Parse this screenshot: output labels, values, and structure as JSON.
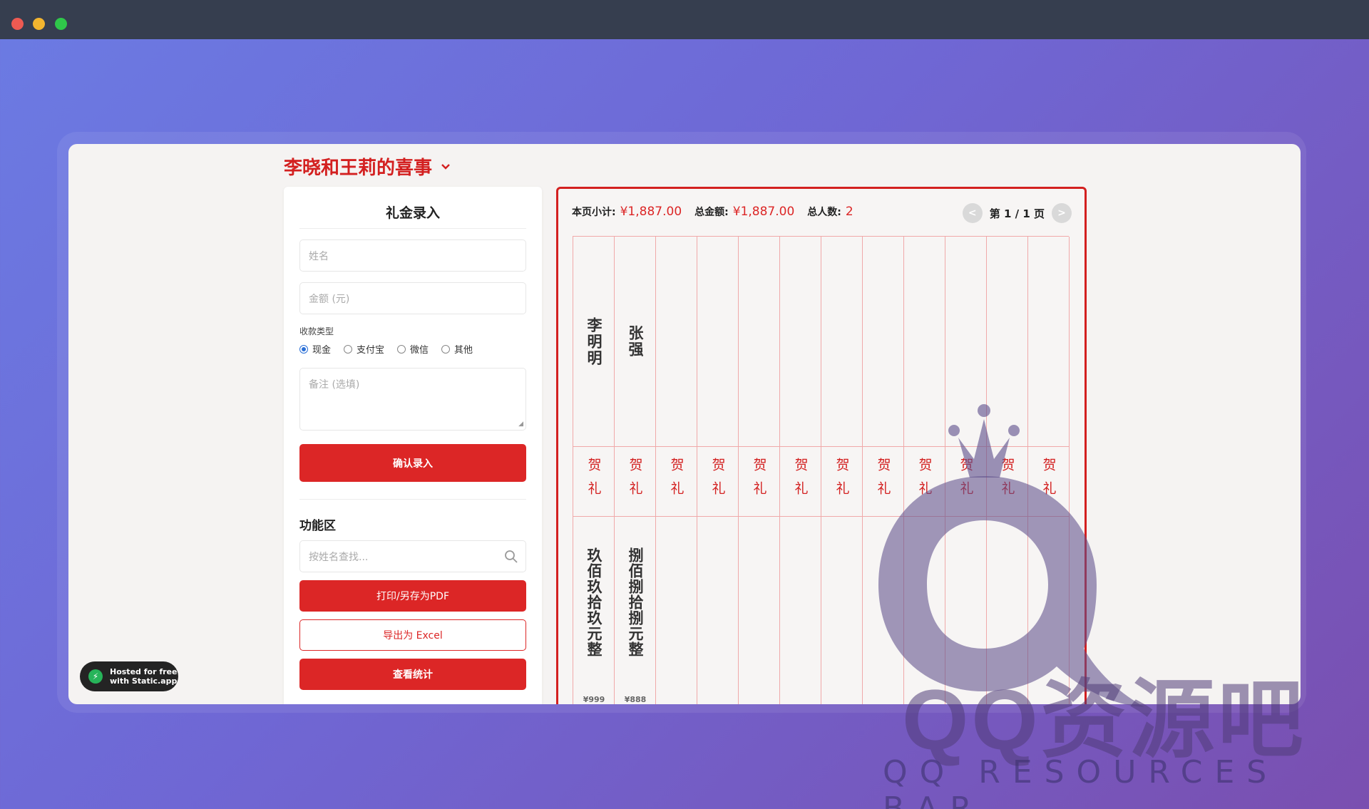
{
  "window_dots": [
    "close",
    "minimize",
    "maximize"
  ],
  "page": {
    "title": "李晓和王莉的喜事"
  },
  "form": {
    "title": "礼金录入",
    "name_placeholder": "姓名",
    "amount_placeholder": "金额 (元)",
    "pay_type_label": "收款类型",
    "pay_types": [
      {
        "label": "现金",
        "checked": true
      },
      {
        "label": "支付宝",
        "checked": false
      },
      {
        "label": "微信",
        "checked": false
      },
      {
        "label": "其他",
        "checked": false
      }
    ],
    "note_placeholder": "备注 (选填)",
    "confirm_label": "确认录入",
    "functions_title": "功能区",
    "search_placeholder": "按姓名查找...",
    "print_label": "打印/另存为PDF",
    "export_label": "导出为 Excel",
    "stats_label": "查看统计"
  },
  "ledger": {
    "subtotal_label": "本页小计:",
    "subtotal_value": "¥1,887.00",
    "total_label": "总金额:",
    "total_value": "¥1,887.00",
    "count_label": "总人数:",
    "count_value": "2",
    "page_text": "第 1 / 1 页",
    "prev": "<",
    "next": ">",
    "gift_text": "贺礼",
    "entries": [
      {
        "name": "李明明",
        "amount_words": "玖佰玖拾玖元整",
        "amount_small": "¥999"
      },
      {
        "name": "张强",
        "amount_words": "捌佰捌拾捌元整",
        "amount_small": "¥888"
      }
    ],
    "column_count": 12
  },
  "watermark": {
    "text": "QQ资源吧",
    "subtitle": "QQ RESOURCES BAR"
  },
  "badge": {
    "line1": "Hosted for free",
    "line2": "with Static.app",
    "icon": "bolt-icon"
  },
  "colors": {
    "accent": "#dc2626",
    "title": "#d32020",
    "grid": "#f0a9a9"
  }
}
